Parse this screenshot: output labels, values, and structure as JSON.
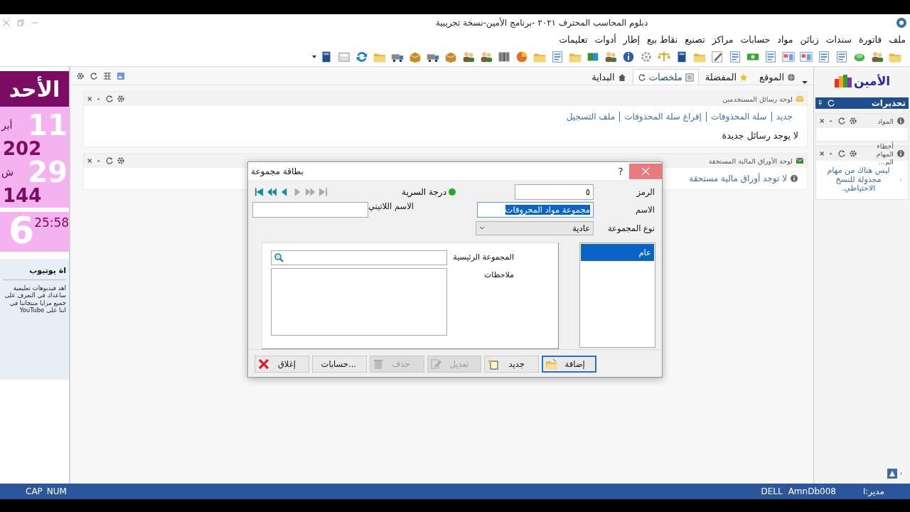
{
  "window": {
    "title": "دبلوم المحاسب المحترف ٢٠٢١ -برنامج الأمين-نسخة تجريبية"
  },
  "menu": [
    "ملف",
    "فاتورة",
    "سندات",
    "زبائن",
    "مواد",
    "حسابات",
    "مراكز",
    "تصنيع",
    "نقاط بيع",
    "إطار",
    "أدوات",
    "تعليمات"
  ],
  "tabs": [
    {
      "label": "الموقع",
      "kind": "globe",
      "selected": false
    },
    {
      "label": "المفضلة",
      "kind": "star",
      "selected": false
    },
    {
      "label": "ملخصات",
      "kind": "list",
      "selected": true
    },
    {
      "label": "البداية",
      "kind": "home",
      "selected": false
    }
  ],
  "panels": [
    {
      "kind": "messages",
      "title": "لوحة رسائل المستخدمين",
      "links": [
        "جديد",
        "سلة المحذوفات",
        "إفراغ سلة المحذوفات",
        "ملف التسجيل"
      ],
      "message": "لا يوجد رسائل جديدة"
    },
    {
      "kind": "notice",
      "title": "لوحة الأوراق المالية المستحقة",
      "message": "لا توجد أوراق مالية مستحقة"
    }
  ],
  "calendar": {
    "weekday": "الأحد",
    "day": "11",
    "month": "أبر",
    "year": "202",
    "hijri_day": "29",
    "hijri_month": "ش",
    "hijri_year": "144",
    "hour": "6",
    "time": "25:58"
  },
  "youtube": {
    "title": "اة يوتيوب",
    "lines": [
      "اهد فيديوهات تعليمية",
      "ساعدك في التعرف على",
      "جميع مزايا منتجاتنا في",
      "اتنا على YouTube"
    ]
  },
  "sidebar": {
    "logo": "الأمين",
    "header": "تحذيرات",
    "widgets": [
      {
        "title": "المواد"
      },
      {
        "title": "أخطاء المهام الم...",
        "text": "ليس هناك من مهام مجدولة للنسخ الاحتياطي."
      }
    ]
  },
  "dialog": {
    "title": "بطاقة مجموعة",
    "help": "?",
    "code": {
      "label": "الرمز",
      "value": "٥"
    },
    "name": {
      "label": "الاسم",
      "value": "مجموعة مواد المحروقات",
      "selected": true
    },
    "latin_name": {
      "label": "الاسم اللاتيني"
    },
    "group_type": {
      "label": "نوع المجموعة",
      "value": "عادية"
    },
    "secrecy": {
      "label": "درجة السرية",
      "color": "#22aa22"
    },
    "nav": [
      {
        "kind": "first",
        "disabled": false
      },
      {
        "kind": "fast-back",
        "disabled": false
      },
      {
        "kind": "back",
        "disabled": false
      },
      {
        "kind": "forward",
        "disabled": true
      },
      {
        "kind": "fast-forward",
        "disabled": true
      },
      {
        "kind": "last",
        "disabled": true
      }
    ],
    "list": [
      {
        "label": "عام",
        "selected": true
      }
    ],
    "parent_group": {
      "label": "المجموعة الرئيسية"
    },
    "notes": {
      "label": "ملاحظات"
    },
    "buttons": [
      {
        "label": "إضافة",
        "kind": "add",
        "disabled": false,
        "focused": true
      },
      {
        "label": "جديد",
        "kind": "new",
        "disabled": false,
        "focused": false
      },
      {
        "label": "تعديل",
        "kind": "edit",
        "disabled": true,
        "focused": false
      },
      {
        "label": "حذف",
        "kind": "delete",
        "disabled": true,
        "focused": false
      },
      {
        "label": "حسابات...",
        "kind": "plain",
        "disabled": false,
        "focused": false
      },
      {
        "label": "إغلاق",
        "kind": "close",
        "disabled": false,
        "focused": false
      }
    ]
  },
  "status_bar": {
    "user": "مدير:ا",
    "database": "AmnDb008",
    "machine": "DELL",
    "keys": [
      "NUM",
      "CAP"
    ]
  }
}
